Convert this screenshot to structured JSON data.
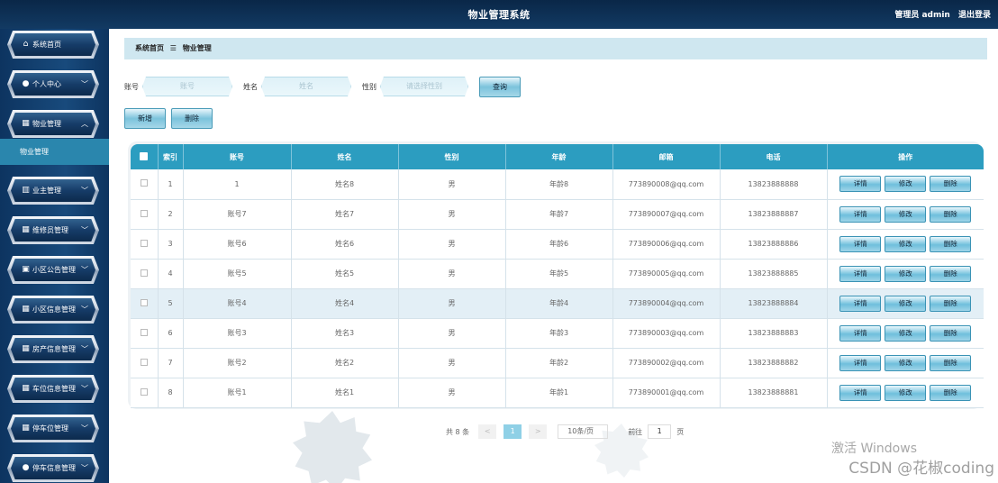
{
  "header": {
    "title": "物业管理系统",
    "user_label": "管理员 admin",
    "logout_label": "退出登录"
  },
  "sidebar": {
    "items": [
      {
        "label": "系统首页",
        "icon": "home-icon"
      },
      {
        "label": "个人中心",
        "icon": "user-icon"
      },
      {
        "label": "物业管理",
        "icon": "grid-icon"
      },
      {
        "label": "业主管理",
        "icon": "bar-chart-icon"
      },
      {
        "label": "维修员管理",
        "icon": "grid-icon"
      },
      {
        "label": "小区公告管理",
        "icon": "notice-icon"
      },
      {
        "label": "小区信息管理",
        "icon": "grid-icon"
      },
      {
        "label": "房产信息管理",
        "icon": "grid-icon"
      },
      {
        "label": "车位信息管理",
        "icon": "grid-icon"
      },
      {
        "label": "停车位管理",
        "icon": "grid-icon"
      },
      {
        "label": "停车信息管理",
        "icon": "user-icon"
      }
    ],
    "active_sub": "物业管理"
  },
  "breadcrumb": {
    "home": "系统首页",
    "sep": "☰",
    "current": "物业管理"
  },
  "search": {
    "account_label": "账号",
    "account_placeholder": "账号",
    "name_label": "姓名",
    "name_placeholder": "姓名",
    "gender_label": "性别",
    "gender_placeholder": "请选择性别",
    "query_button": "查询"
  },
  "actions": {
    "add": "新增",
    "delete": "删除"
  },
  "table": {
    "headers": [
      "索引",
      "账号",
      "姓名",
      "性别",
      "年龄",
      "邮箱",
      "电话",
      "操作"
    ],
    "rows": [
      [
        "1",
        "1",
        "姓名8",
        "男",
        "年龄8",
        "773890008@qq.com",
        "13823888888"
      ],
      [
        "2",
        "账号7",
        "姓名7",
        "男",
        "年龄7",
        "773890007@qq.com",
        "13823888887"
      ],
      [
        "3",
        "账号6",
        "姓名6",
        "男",
        "年龄6",
        "773890006@qq.com",
        "13823888886"
      ],
      [
        "4",
        "账号5",
        "姓名5",
        "男",
        "年龄5",
        "773890005@qq.com",
        "13823888885"
      ],
      [
        "5",
        "账号4",
        "姓名4",
        "男",
        "年龄4",
        "773890004@qq.com",
        "13823888884"
      ],
      [
        "6",
        "账号3",
        "姓名3",
        "男",
        "年龄3",
        "773890003@qq.com",
        "13823888883"
      ],
      [
        "7",
        "账号2",
        "姓名2",
        "男",
        "年龄2",
        "773890002@qq.com",
        "13823888882"
      ],
      [
        "8",
        "账号1",
        "姓名1",
        "男",
        "年龄1",
        "773890001@qq.com",
        "13823888881"
      ]
    ],
    "op_detail": "详情",
    "op_edit": "修改",
    "op_delete": "删除"
  },
  "pager": {
    "total": "共 8 条",
    "prev": "<",
    "page": "1",
    "next": ">",
    "size": "10条/页",
    "goto": "前往",
    "goto_value": "1",
    "page_unit": "页"
  },
  "watermark": {
    "line1": "激活 Windows",
    "line2": "CSDN @花椒coding"
  },
  "colors": {
    "header_bg": "#0f3358",
    "accent": "#2c9dc0",
    "sidebar_active": "#2a86ad"
  }
}
